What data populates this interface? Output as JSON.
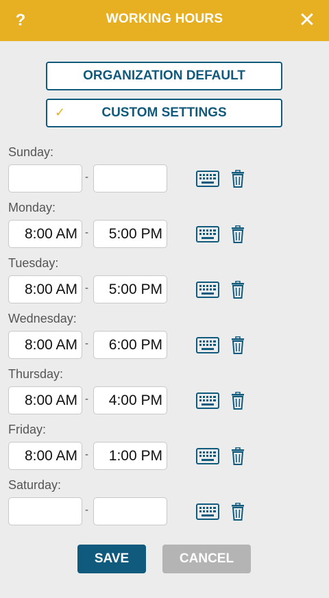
{
  "header": {
    "help_label": "?",
    "title": "WORKING HOURS",
    "close_label": "✕"
  },
  "mode": {
    "org_default_label": "ORGANIZATION DEFAULT",
    "custom_label": "CUSTOM SETTINGS",
    "selected": "custom",
    "check_glyph": "✓"
  },
  "days": [
    {
      "label": "Sunday:",
      "start": "",
      "end": ""
    },
    {
      "label": "Monday:",
      "start": "8:00 AM",
      "end": "5:00 PM"
    },
    {
      "label": "Tuesday:",
      "start": "8:00 AM",
      "end": "5:00 PM"
    },
    {
      "label": "Wednesday:",
      "start": "8:00 AM",
      "end": "6:00 PM"
    },
    {
      "label": "Thursday:",
      "start": "8:00 AM",
      "end": "4:00 PM"
    },
    {
      "label": "Friday:",
      "start": "8:00 AM",
      "end": "1:00 PM"
    },
    {
      "label": "Saturday:",
      "start": "",
      "end": ""
    }
  ],
  "separator": "-",
  "icons": {
    "keyboard": "keyboard-icon",
    "trash": "trash-icon"
  },
  "footer": {
    "save_label": "SAVE",
    "cancel_label": "CANCEL"
  },
  "colors": {
    "header_bg": "#e6b022",
    "primary": "#105a7d",
    "cancel_bg": "#b4b4b4",
    "check": "#e6b022"
  }
}
